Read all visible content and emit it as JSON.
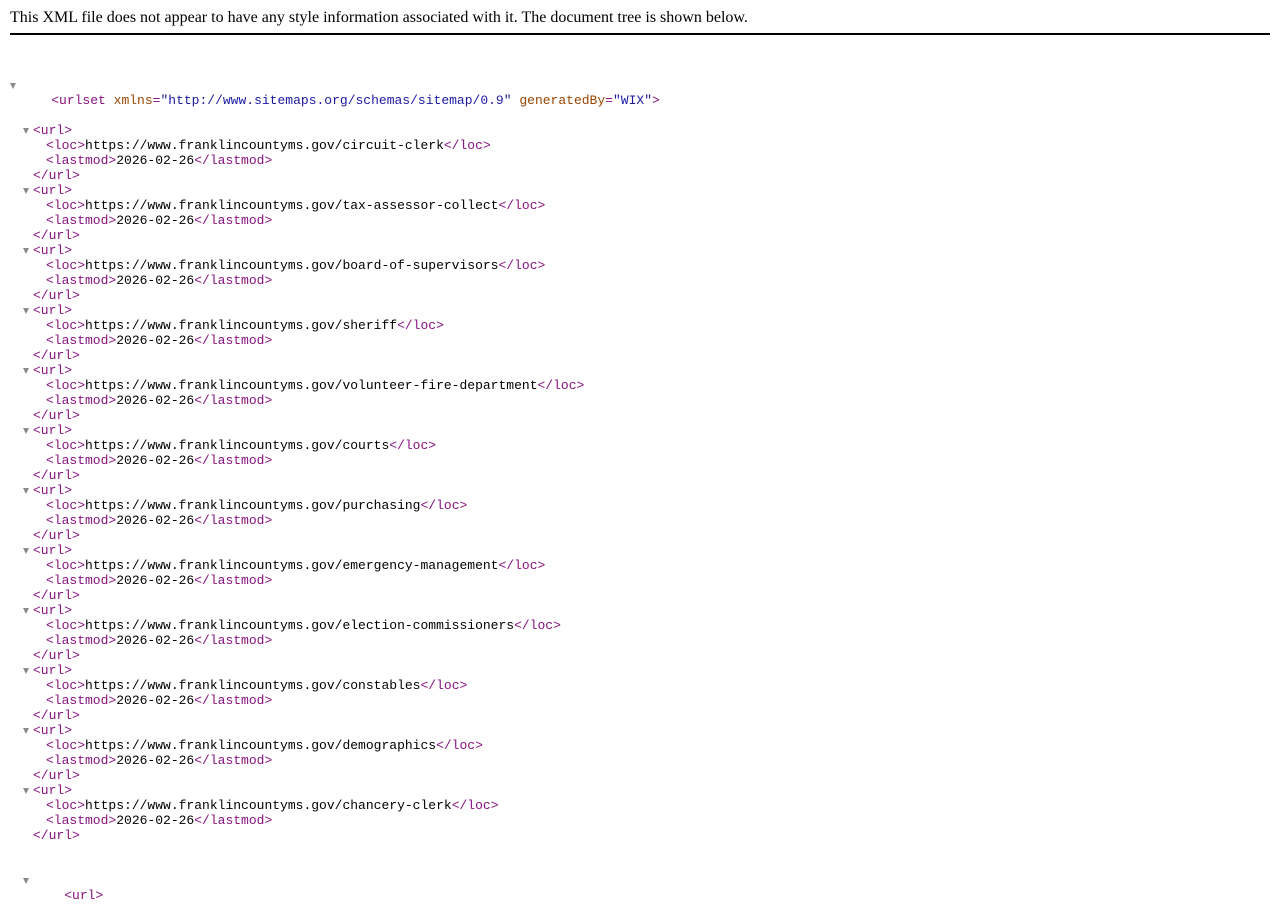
{
  "notice": "This XML file does not appear to have any style information associated with it. The document tree is shown below.",
  "root": {
    "open": "<urlset",
    "attrs": [
      {
        "name": "xmlns",
        "value": "\"http://www.sitemaps.org/schemas/sitemap/0.9\""
      },
      {
        "name": "generatedBy",
        "value": "\"WIX\""
      }
    ],
    "open_close": ">"
  },
  "tags": {
    "url_open": "<url>",
    "url_close": "</url>",
    "loc_open": "<loc>",
    "loc_close": "</loc>",
    "lastmod_open": "<lastmod>",
    "lastmod_close": "</lastmod>"
  },
  "urls": [
    {
      "loc": "https://www.franklincountyms.gov/circuit-clerk",
      "lastmod": "2026-02-26"
    },
    {
      "loc": "https://www.franklincountyms.gov/tax-assessor-collect",
      "lastmod": "2026-02-26"
    },
    {
      "loc": "https://www.franklincountyms.gov/board-of-supervisors",
      "lastmod": "2026-02-26"
    },
    {
      "loc": "https://www.franklincountyms.gov/sheriff",
      "lastmod": "2026-02-26"
    },
    {
      "loc": "https://www.franklincountyms.gov/volunteer-fire-department",
      "lastmod": "2026-02-26"
    },
    {
      "loc": "https://www.franklincountyms.gov/courts",
      "lastmod": "2026-02-26"
    },
    {
      "loc": "https://www.franklincountyms.gov/purchasing",
      "lastmod": "2026-02-26"
    },
    {
      "loc": "https://www.franklincountyms.gov/emergency-management",
      "lastmod": "2026-02-26"
    },
    {
      "loc": "https://www.franklincountyms.gov/election-commissioners",
      "lastmod": "2026-02-26"
    },
    {
      "loc": "https://www.franklincountyms.gov/constables",
      "lastmod": "2026-02-26"
    },
    {
      "loc": "https://www.franklincountyms.gov/demographics",
      "lastmod": "2026-02-26"
    },
    {
      "loc": "https://www.franklincountyms.gov/chancery-clerk",
      "lastmod": "2026-02-26"
    }
  ],
  "trailing_partial_open": "<url>",
  "colors": {
    "tag": "#881280",
    "attr_name": "#994500",
    "attr_value": "#1a1aa6",
    "triangle": "#8a8a8a"
  },
  "icons": {
    "expander": "collapse-triangle-icon"
  }
}
